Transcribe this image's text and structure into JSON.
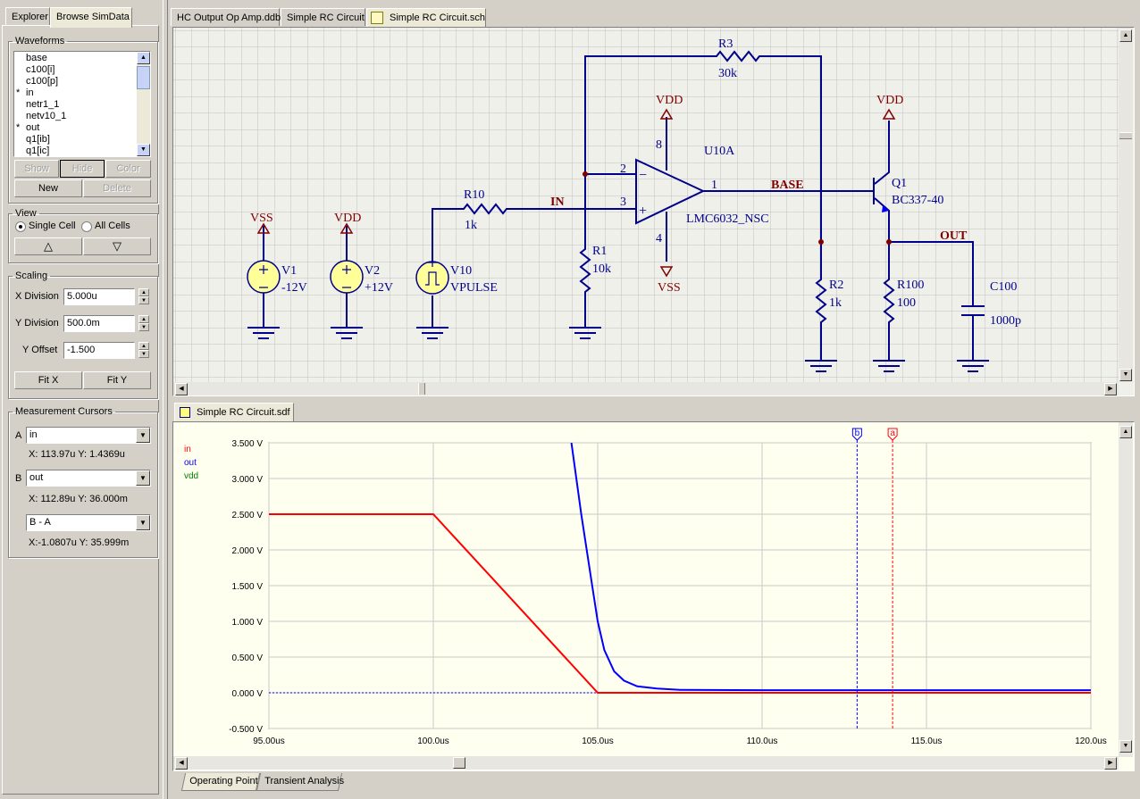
{
  "left_panel": {
    "tabs": [
      "Explorer",
      "Browse SimData"
    ],
    "waveforms": {
      "legend": "Waveforms",
      "items": [
        {
          "mark": "",
          "name": "base"
        },
        {
          "mark": "",
          "name": "c100[i]"
        },
        {
          "mark": "",
          "name": "c100[p]"
        },
        {
          "mark": "*",
          "name": "in"
        },
        {
          "mark": "",
          "name": "netr1_1"
        },
        {
          "mark": "",
          "name": "netv10_1"
        },
        {
          "mark": "*",
          "name": "out"
        },
        {
          "mark": "",
          "name": "q1[ib]"
        },
        {
          "mark": "",
          "name": "q1[ic]"
        }
      ],
      "show_label": "Show",
      "hide_label": "Hide",
      "color_label": "Color",
      "new_label": "New",
      "delete_label": "Delete"
    },
    "view": {
      "legend": "View",
      "single_cell_label": "Single Cell",
      "all_cells_label": "All Cells",
      "selected": "Single Cell",
      "up_glyph": "△",
      "down_glyph": "▽"
    },
    "scaling": {
      "legend": "Scaling",
      "x_division_label": "X Division",
      "x_division_value": "5.000u",
      "y_division_label": "Y Division",
      "y_division_value": "500.0m",
      "y_offset_label": "Y Offset",
      "y_offset_value": "-1.500",
      "fit_x_label": "Fit X",
      "fit_y_label": "Fit Y"
    },
    "cursors": {
      "legend": "Measurement Cursors",
      "a_label": "A",
      "a_value": "in",
      "a_readout": "X: 113.97u  Y: 1.4369u",
      "b_label": "B",
      "b_value": "out",
      "b_readout": "X: 112.89u  Y: 36.000m",
      "diff_value": "B - A",
      "diff_readout": "X:-1.0807u  Y: 35.999m"
    }
  },
  "document_tabs": [
    "HC Output Op Amp.ddb",
    "Simple RC Circuit",
    "Simple RC Circuit.sch"
  ],
  "schematic": {
    "labels": {
      "r3": "R3",
      "r3_val": "30k",
      "vdd_op": "VDD",
      "vdd_q": "VDD",
      "u10a": "U10A",
      "pin8": "8",
      "pin2": "2",
      "pin3": "3",
      "pin1": "1",
      "pin4": "4",
      "opamp_part": "LMC6032_NSC",
      "base_net": "BASE",
      "in_net": "IN",
      "out_net": "OUT",
      "q1": "Q1",
      "q1_part": "BC337-40",
      "r10": "R10",
      "r10_val": "1k",
      "r1": "R1",
      "r1_val": "10k",
      "vss_op": "VSS",
      "vss_v1": "VSS",
      "vdd_v2": "VDD",
      "v1": "V1",
      "v1_val": "-12V",
      "v2": "V2",
      "v2_val": "+12V",
      "v10": "V10",
      "v10_val": "VPULSE",
      "r2": "R2",
      "r2_val": "1k",
      "r100": "R100",
      "r100_val": "100",
      "c100": "C100",
      "c100_val": "1000p",
      "minus": "−",
      "plus": "+"
    }
  },
  "sim_tab": "Simple RC Circuit.sdf",
  "bottom_tabs": [
    "Operating Point",
    "Transient Analysis"
  ],
  "colors": {
    "wire": "#00008b",
    "component": "#00008b",
    "net_label": "#800000",
    "trace_in": "#ff0000",
    "trace_out": "#0000ff",
    "trace_vdd": "#008000",
    "plot_bg": "#fffff0"
  },
  "chart_data": {
    "type": "line",
    "legend": [
      "in",
      "out",
      "vdd"
    ],
    "legend_placement": "top-left",
    "xlabel": "",
    "ylabel": "",
    "xlim": [
      95.0,
      120.0
    ],
    "ylim": [
      -0.5,
      3.5
    ],
    "x_ticks": [
      "95.00us",
      "100.0us",
      "105.0us",
      "110.0us",
      "115.0us",
      "120.0us"
    ],
    "x_tick_values": [
      95,
      100,
      105,
      110,
      115,
      120
    ],
    "y_ticks": [
      "3.500 V",
      "3.000 V",
      "2.500 V",
      "2.000 V",
      "1.500 V",
      "1.000 V",
      "0.500 V",
      "0.000 V",
      "-0.500 V"
    ],
    "y_tick_values": [
      3.5,
      3.0,
      2.5,
      2.0,
      1.5,
      1.0,
      0.5,
      0.0,
      -0.5
    ],
    "grid": true,
    "series": [
      {
        "name": "in",
        "color": "#ff0000",
        "x": [
          95,
          100,
          105,
          120
        ],
        "y": [
          2.5,
          2.5,
          0.0,
          0.0
        ]
      },
      {
        "name": "out",
        "color": "#0000ff",
        "x": [
          104.2,
          104.5,
          104.8,
          105.0,
          105.2,
          105.5,
          105.8,
          106.2,
          106.8,
          107.5,
          110,
          120
        ],
        "y": [
          3.5,
          2.5,
          1.6,
          1.0,
          0.6,
          0.3,
          0.17,
          0.09,
          0.06,
          0.04,
          0.036,
          0.036
        ]
      },
      {
        "name": "vdd",
        "color": "#008000",
        "x": [],
        "y": []
      }
    ],
    "cursors": [
      {
        "name": "b",
        "x": 112.89,
        "color": "#0000ff"
      },
      {
        "name": "a",
        "x": 113.97,
        "color": "#ff0000"
      }
    ]
  }
}
